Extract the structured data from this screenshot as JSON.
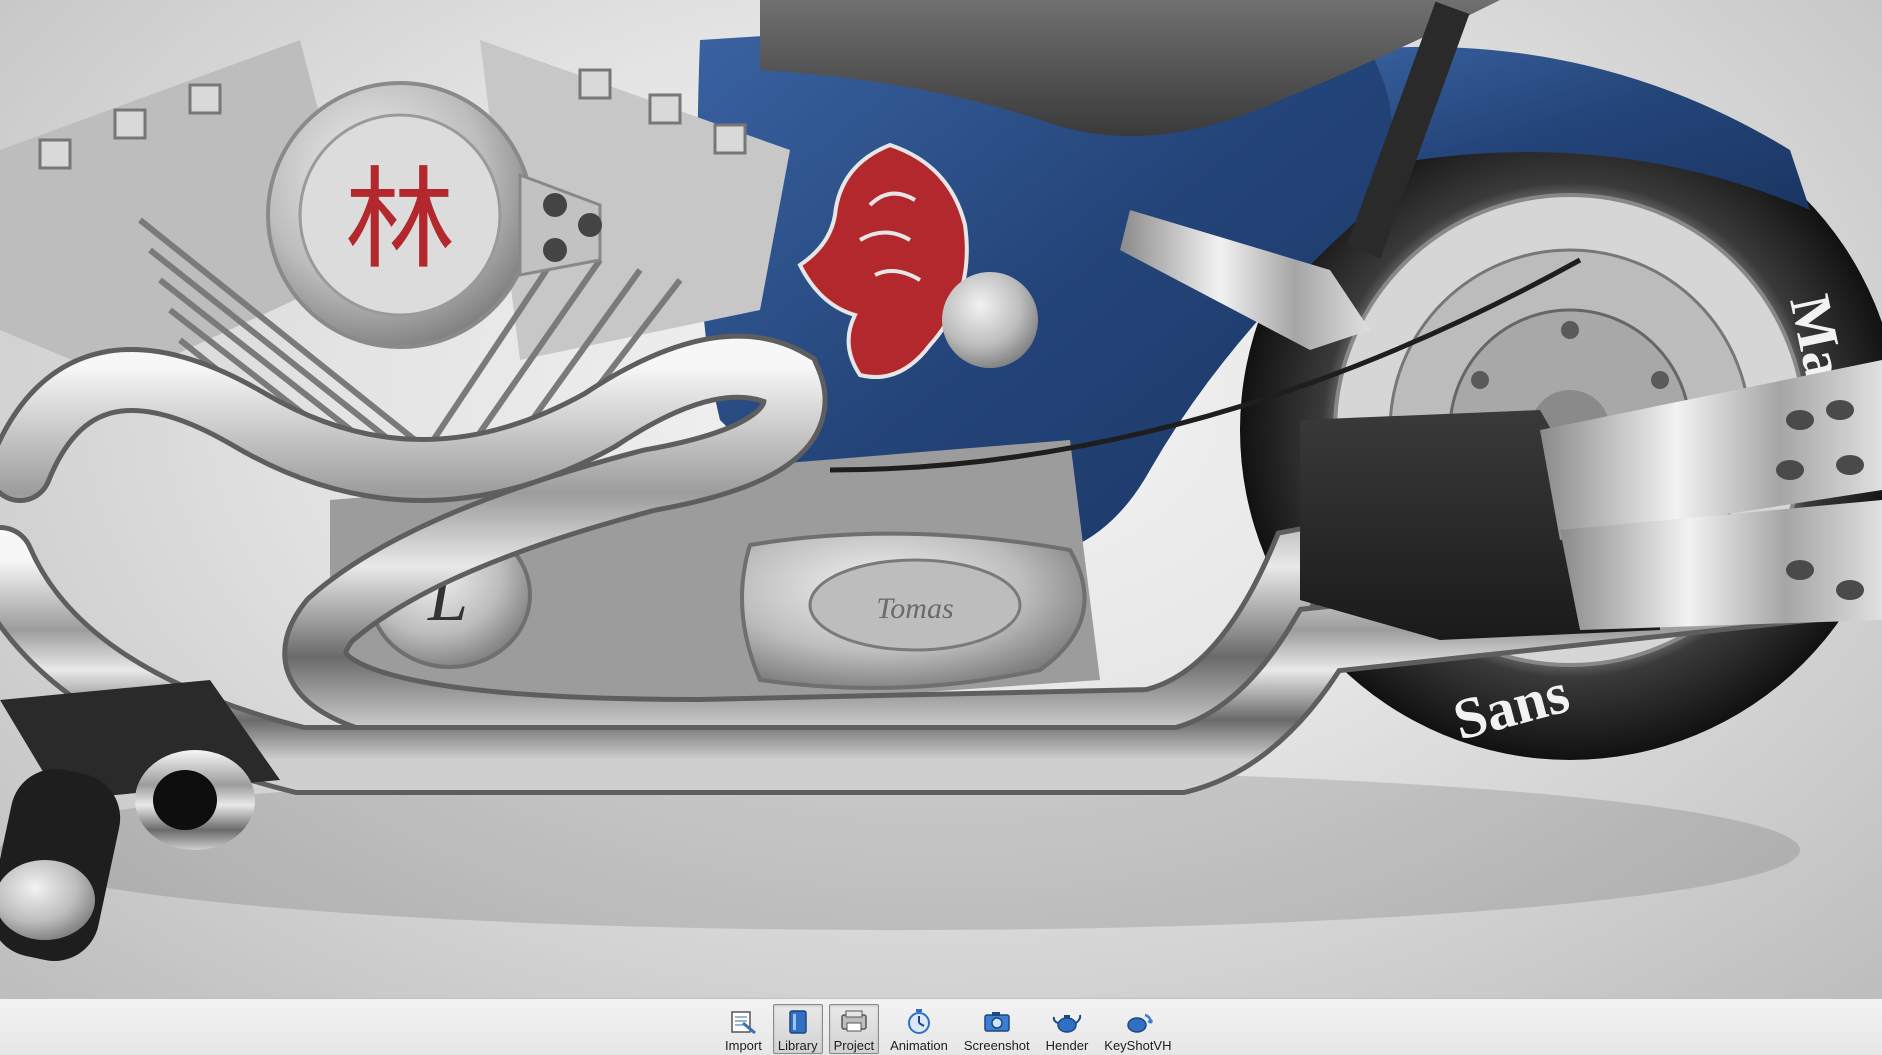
{
  "viewport": {
    "tank_glyph": "林",
    "engine_cover_letter": "L",
    "primary_cover_script": "Tomas",
    "tire_lettering_top": "Mau",
    "tire_lettering_bottom": "Sans"
  },
  "toolbar": {
    "buttons": [
      {
        "label": "Import",
        "icon": "import-icon",
        "active": false
      },
      {
        "label": "Library",
        "icon": "library-icon",
        "active": true
      },
      {
        "label": "Project",
        "icon": "project-icon",
        "active": true
      },
      {
        "label": "Animation",
        "icon": "animation-icon",
        "active": false
      },
      {
        "label": "Screenshot",
        "icon": "screenshot-icon",
        "active": false
      },
      {
        "label": "Hender",
        "icon": "render-teapot-icon",
        "active": false
      },
      {
        "label": "KeyShotVH",
        "icon": "keyshotvr-icon",
        "active": false
      }
    ]
  },
  "colors": {
    "frame_blue": "#2d4f86",
    "lion_red": "#b2282c",
    "chrome": "#c9c9c9",
    "toolbar_bg": "#ececec"
  }
}
